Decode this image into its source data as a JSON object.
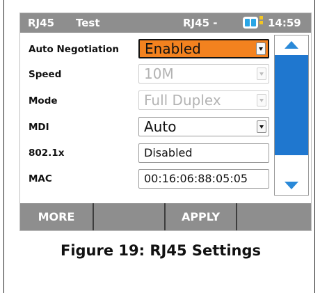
{
  "status_bar": {
    "left_tab": "RJ45",
    "mode": "Test",
    "port": "RJ45 -",
    "time": "14:59",
    "battery_icon": "battery-icon"
  },
  "settings": {
    "auto_negotiation": {
      "label": "Auto Negotiation",
      "value": "Enabled",
      "state": "focused"
    },
    "speed": {
      "label": "Speed",
      "value": "10M",
      "state": "disabled"
    },
    "mode": {
      "label": "Mode",
      "value": "Full Duplex",
      "state": "disabled"
    },
    "mdi": {
      "label": "MDI",
      "value": "Auto",
      "state": "enabled"
    },
    "dot1x": {
      "label": "802.1x",
      "value": "Disabled"
    },
    "mac": {
      "label": "MAC",
      "value": "00:16:06:88:05:05"
    }
  },
  "scrollbar": {
    "up_icon": "arrow-up-icon",
    "down_icon": "arrow-down-icon"
  },
  "softkeys": [
    "MORE",
    "",
    "APPLY",
    ""
  ],
  "caption": "Figure 19: RJ45 Settings",
  "colors": {
    "status_bar": "#8e8e8e",
    "focus_highlight": "#f3821f",
    "scroll_thumb": "#1f77cf",
    "arrow": "#2a89d8"
  }
}
